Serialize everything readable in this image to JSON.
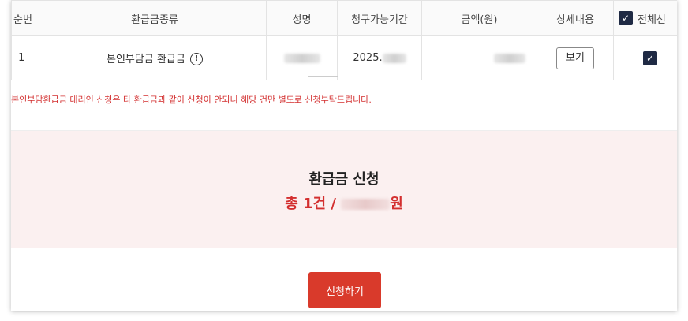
{
  "table": {
    "headers": {
      "no": "순번",
      "type": "환급금종류",
      "name": "성명",
      "period": "청구가능기간",
      "amount": "금액(원)",
      "detail": "상세내용",
      "select_all": "전체선"
    },
    "rows": [
      {
        "no": "1",
        "type": "본인부담금 환급금",
        "period_visible": "2025.",
        "detail_button": "보기",
        "checked": true
      }
    ]
  },
  "notice": "본인부담환급금 대리인 신청은 타 환급금과 같이 신청이 안되니 해당 건만 별도로 신청부탁드립니다.",
  "summary": {
    "title": "환급금 신청",
    "total_prefix": "총 1건 /",
    "total_suffix": "원"
  },
  "apply_button": "신청하기",
  "colors": {
    "accent_red": "#d93a2b",
    "notice_red": "#d32f2f",
    "summary_bg": "#fbf0f0",
    "checkbox_navy": "#1f2a44"
  },
  "icons": {
    "info": "info-circle-icon",
    "check": "check-icon"
  }
}
